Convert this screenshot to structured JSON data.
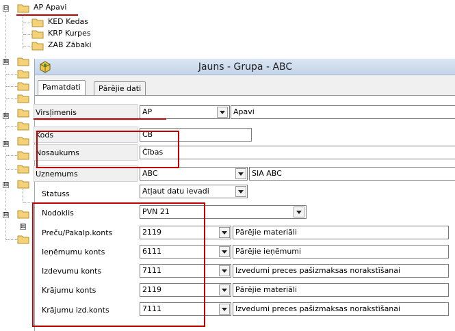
{
  "tree": {
    "root": {
      "label": "AP Apavi",
      "expander": "⊟"
    },
    "children": [
      {
        "label": "KED Kedas"
      },
      {
        "label": "KRP Kurpes"
      },
      {
        "label": "ZAB Zābaki"
      }
    ],
    "collapsed_expanders": [
      "⊞",
      "⊞",
      "⊞",
      "⊟",
      "⊟",
      "⊞"
    ]
  },
  "window": {
    "title": "Jauns - Grupa - ABC",
    "tabs": [
      {
        "label": "Pamatdati"
      },
      {
        "label": "Pārējie dati"
      }
    ]
  },
  "form": {
    "virsgrupa": {
      "label": "Virsļimenis",
      "value": "AP",
      "desc": "Apavi"
    },
    "kods": {
      "label": "Kods",
      "value": "CB"
    },
    "nosaukums": {
      "label": "Nosaukums",
      "value": "Čības"
    },
    "uznemums": {
      "label": "Uznemums",
      "value": "ABC",
      "desc": "SIA ABC"
    },
    "statuss": {
      "label": "Statuss",
      "value": "Atļaut datu ievadi"
    },
    "nodoklis": {
      "label": "Nodoklis",
      "value": "PVN 21"
    },
    "accounts": [
      {
        "label": "Preču/Pakalp.konts",
        "value": "2119",
        "desc": "Pārējie materiāli"
      },
      {
        "label": "Ieņēmumu konts",
        "value": "6111",
        "desc": "Pārējie ieņēmumi"
      },
      {
        "label": "Izdevumu konts",
        "value": "7111",
        "desc": "Izvedumi preces pašizmaksas norakstīšanai"
      },
      {
        "label": "Krājumu konts",
        "value": "2119",
        "desc": "Pārējie materiāli"
      },
      {
        "label": "Krājumu izd.konts",
        "value": "7111",
        "desc": "Izvedumi preces pašizmaksas norakstīšanai"
      }
    ]
  },
  "colors": {
    "annotation": "#c00000",
    "titlebar": "#c3d3e8",
    "folder": "#f3d27a"
  }
}
